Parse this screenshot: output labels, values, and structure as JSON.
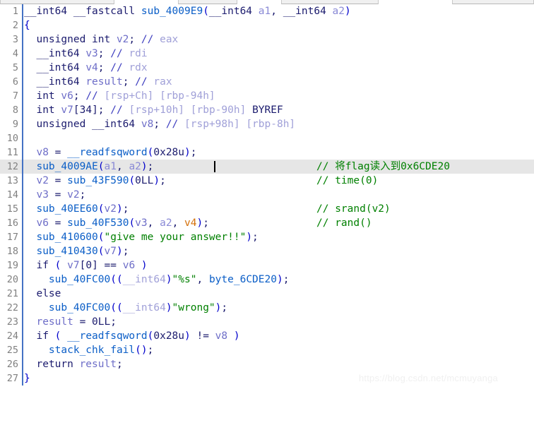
{
  "window": {
    "app": "IDA Pro Pseudocode View",
    "tabs": [
      "",
      "",
      "",
      ""
    ]
  },
  "editor": {
    "cursor_line": 12,
    "highlighted_line": 12,
    "accent_color": "#4472c4",
    "highlight_color": "#e6e6e6",
    "gutter_color": "#808080",
    "comment_color": "#008000",
    "string_color": "#008000",
    "function_color": "#0b5ec7",
    "variable_color": "#6e6ec8",
    "uninit_var_color": "#d4700a",
    "keyword_color": "#1b1b6e"
  },
  "code": {
    "lines": [
      {
        "n": "1",
        "text": "__int64 __fastcall sub_4009E9(__int64 a1, __int64 a2)",
        "comment": ""
      },
      {
        "n": "2",
        "text": "{",
        "comment": ""
      },
      {
        "n": "3",
        "text": "  unsigned int v2; // eax",
        "comment": ""
      },
      {
        "n": "4",
        "text": "  __int64 v3; // rdi",
        "comment": ""
      },
      {
        "n": "5",
        "text": "  __int64 v4; // rdx",
        "comment": ""
      },
      {
        "n": "6",
        "text": "  __int64 result; // rax",
        "comment": ""
      },
      {
        "n": "7",
        "text": "  int v6; // [rsp+Ch] [rbp-94h]",
        "comment": ""
      },
      {
        "n": "8",
        "text": "  int v7[34]; // [rsp+10h] [rbp-90h] BYREF",
        "comment": ""
      },
      {
        "n": "9",
        "text": "  unsigned __int64 v8; // [rsp+98h] [rbp-8h]",
        "comment": ""
      },
      {
        "n": "10",
        "text": "",
        "comment": ""
      },
      {
        "n": "11",
        "text": "  v8 = __readfsqword(0x28u);",
        "comment": ""
      },
      {
        "n": "12",
        "text": "  sub_4009AE(a1, a2);",
        "comment": "// 将flag读入到0x6CDE20"
      },
      {
        "n": "13",
        "text": "  v2 = sub_43F590(0LL);",
        "comment": "// time(0)"
      },
      {
        "n": "14",
        "text": "  v3 = v2;",
        "comment": ""
      },
      {
        "n": "15",
        "text": "  sub_40EE60(v2);",
        "comment": "// srand(v2)"
      },
      {
        "n": "16",
        "text": "  v6 = sub_40F530(v3, a2, v4);",
        "comment": "// rand()"
      },
      {
        "n": "17",
        "text": "  sub_410600(\"give me your answer!!\");",
        "comment": ""
      },
      {
        "n": "18",
        "text": "  sub_410430(v7);",
        "comment": ""
      },
      {
        "n": "19",
        "text": "  if ( v7[0] == v6 )",
        "comment": ""
      },
      {
        "n": "20",
        "text": "    sub_40FC00((__int64)\"%s\", byte_6CDE20);",
        "comment": ""
      },
      {
        "n": "21",
        "text": "  else",
        "comment": ""
      },
      {
        "n": "22",
        "text": "    sub_40FC00((__int64)\"wrong\");",
        "comment": ""
      },
      {
        "n": "23",
        "text": "  result = 0LL;",
        "comment": ""
      },
      {
        "n": "24",
        "text": "  if ( __readfsqword(0x28u) != v8 )",
        "comment": ""
      },
      {
        "n": "25",
        "text": "    stack_chk_fail();",
        "comment": ""
      },
      {
        "n": "26",
        "text": "  return result;",
        "comment": ""
      },
      {
        "n": "27",
        "text": "}",
        "comment": ""
      }
    ]
  },
  "watermark": {
    "text": "https://blog.csdn.net/mcmuyanga"
  }
}
